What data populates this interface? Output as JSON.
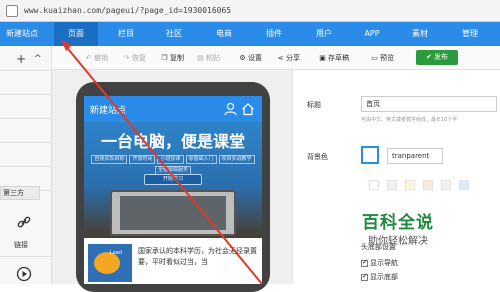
{
  "browser": {
    "url": "www.kuaizhan.com/pageui/?page_id=1930016065"
  },
  "topnav": {
    "brand": "新建站点",
    "items": [
      "页面",
      "栏目",
      "社区",
      "电商",
      "插件",
      "用户",
      "APP",
      "素材",
      "管理"
    ],
    "active": "页面"
  },
  "sidebar": {
    "add_symbol": "+",
    "collapse_symbol": "^",
    "third_party_tab": "第三方",
    "link_label": "链接"
  },
  "toolbar": {
    "undo": "撤销",
    "redo": "恢复",
    "copy": "复制",
    "paste": "粘贴",
    "settings": "设置",
    "share": "分享",
    "save_draft": "存草稿",
    "preview": "预览",
    "publish": "发布"
  },
  "phone": {
    "site_title": "新建站点",
    "banner_heading": "一台电脑，便是课堂",
    "banner_tags": [
      "自我实现目标",
      "开放时间",
      "小班授课",
      "零基础入门",
      "项目实战教学",
      "全程跟踪服务"
    ],
    "banner_button": "开始学习",
    "article_badge": "Lead",
    "article_text": "国家承认的本科学历，为社会无径录置要，平时看似过当，当"
  },
  "panel": {
    "title_label": "标题",
    "title_value": "首页",
    "title_hint": "可由中文、英文或者数字组成，最长10个字",
    "bg_label": "背景色",
    "bg_value": "tranparent",
    "swatch_colors": [
      "#ffffff",
      "#f1f1f1",
      "#fff7dc",
      "#fde9d9",
      "#f2f2f2",
      "#dbeaf8"
    ],
    "header_settings_label": "头底部设置",
    "show_nav": "显示导航",
    "show_footer": "显示底部"
  },
  "watermark": {
    "line1": "百科全说",
    "line2": "助你轻松解决"
  },
  "colors": {
    "nav_blue": "#2a8ce8",
    "nav_active": "#1a6fc4",
    "publish_green": "#2b9b3e",
    "annotation_red": "#e0392b"
  }
}
